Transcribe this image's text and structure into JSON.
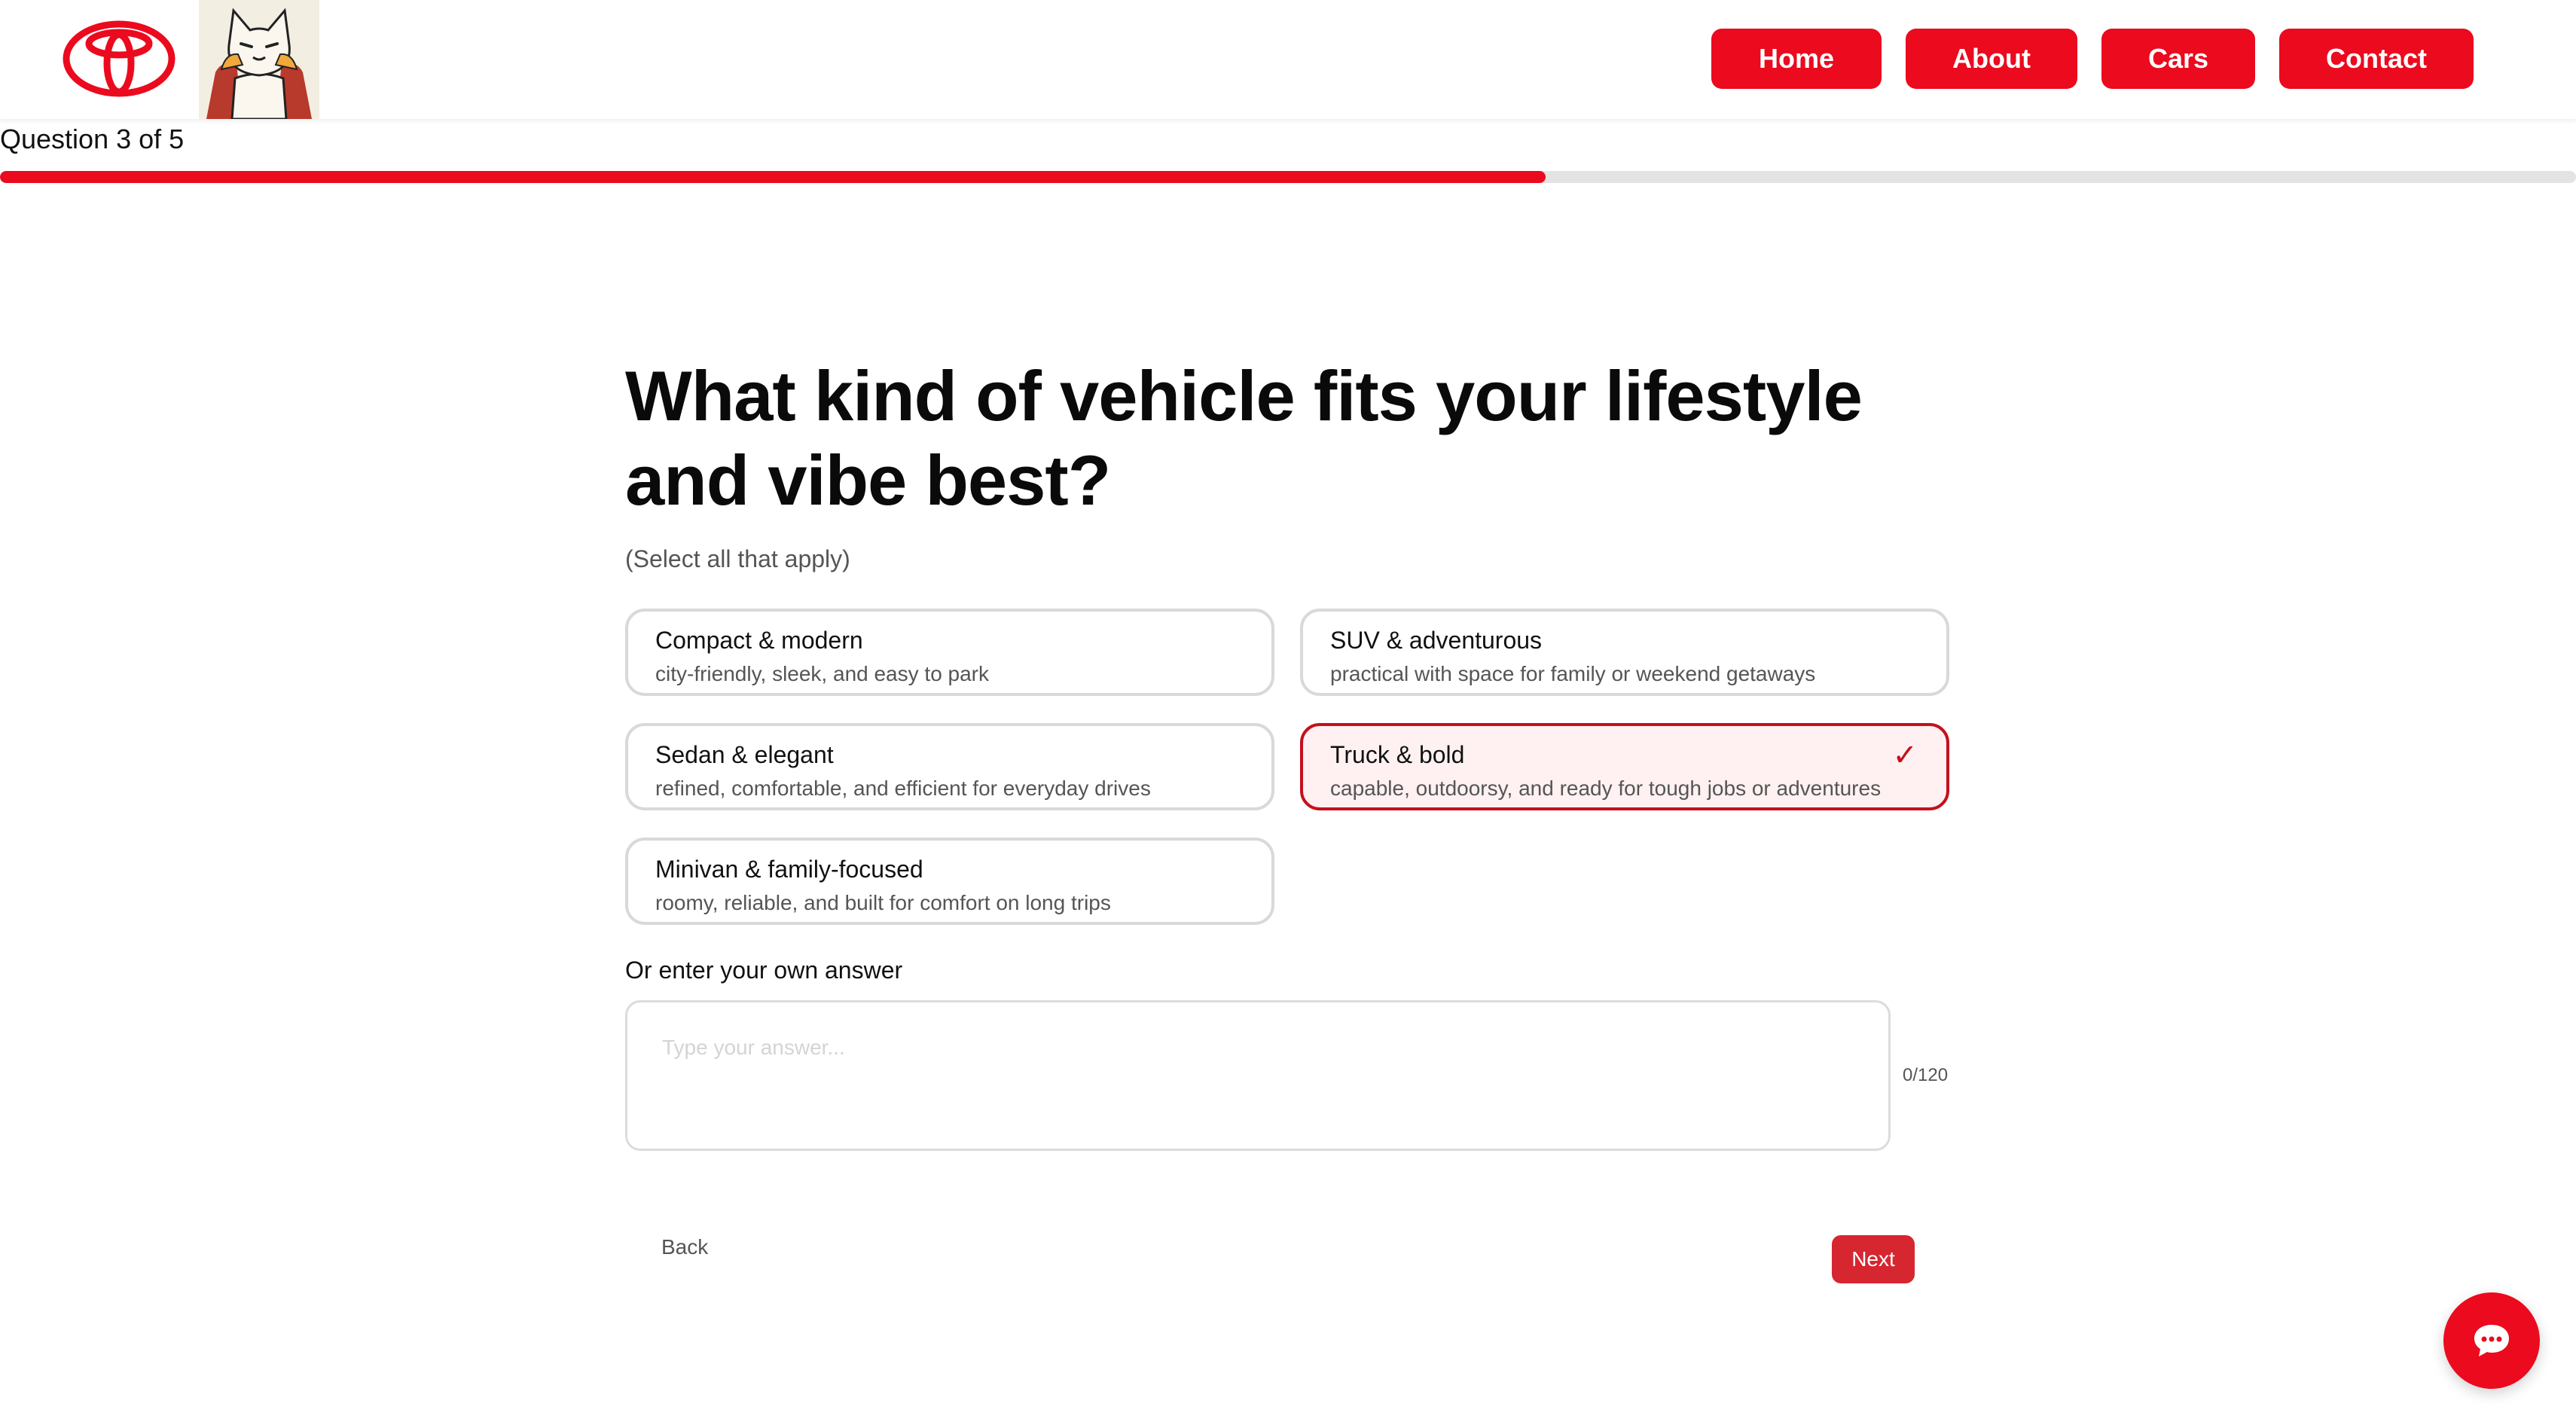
{
  "header": {
    "nav": [
      {
        "label": "Home"
      },
      {
        "label": "About"
      },
      {
        "label": "Cars"
      },
      {
        "label": "Contact"
      }
    ]
  },
  "progress": {
    "label": "Question 3 of 5",
    "fraction": 0.6
  },
  "question": {
    "title": "What kind of vehicle fits your lifestyle and vibe best?",
    "hint": "(Select all that apply)",
    "options": [
      {
        "title": "Compact & modern",
        "desc": "city-friendly, sleek, and easy to park",
        "selected": false
      },
      {
        "title": "SUV & adventurous",
        "desc": "practical with space for family or weekend getaways",
        "selected": false
      },
      {
        "title": "Sedan & elegant",
        "desc": "refined, comfortable, and efficient for everyday drives",
        "selected": false
      },
      {
        "title": "Truck & bold",
        "desc": "capable, outdoorsy, and ready for tough jobs or adventures",
        "selected": true
      },
      {
        "title": "Minivan & family-focused",
        "desc": "roomy, reliable, and built for comfort on long trips",
        "selected": false
      }
    ],
    "check_mark": "✓"
  },
  "own_answer": {
    "label": "Or enter your own answer",
    "placeholder": "Type your answer...",
    "value": "",
    "counter": "0/120"
  },
  "actions": {
    "back_label": "Back",
    "next_label": "Next"
  },
  "colors": {
    "brand_red": "#eb0a1e",
    "selected_border": "#c4101d",
    "selected_bg": "#fff1f2",
    "next_button": "#d62630"
  },
  "icons": {
    "logo": "toyota-logo",
    "mascot": "cat-mascot",
    "chat": "chat-bubble-icon",
    "check": "check-icon"
  }
}
